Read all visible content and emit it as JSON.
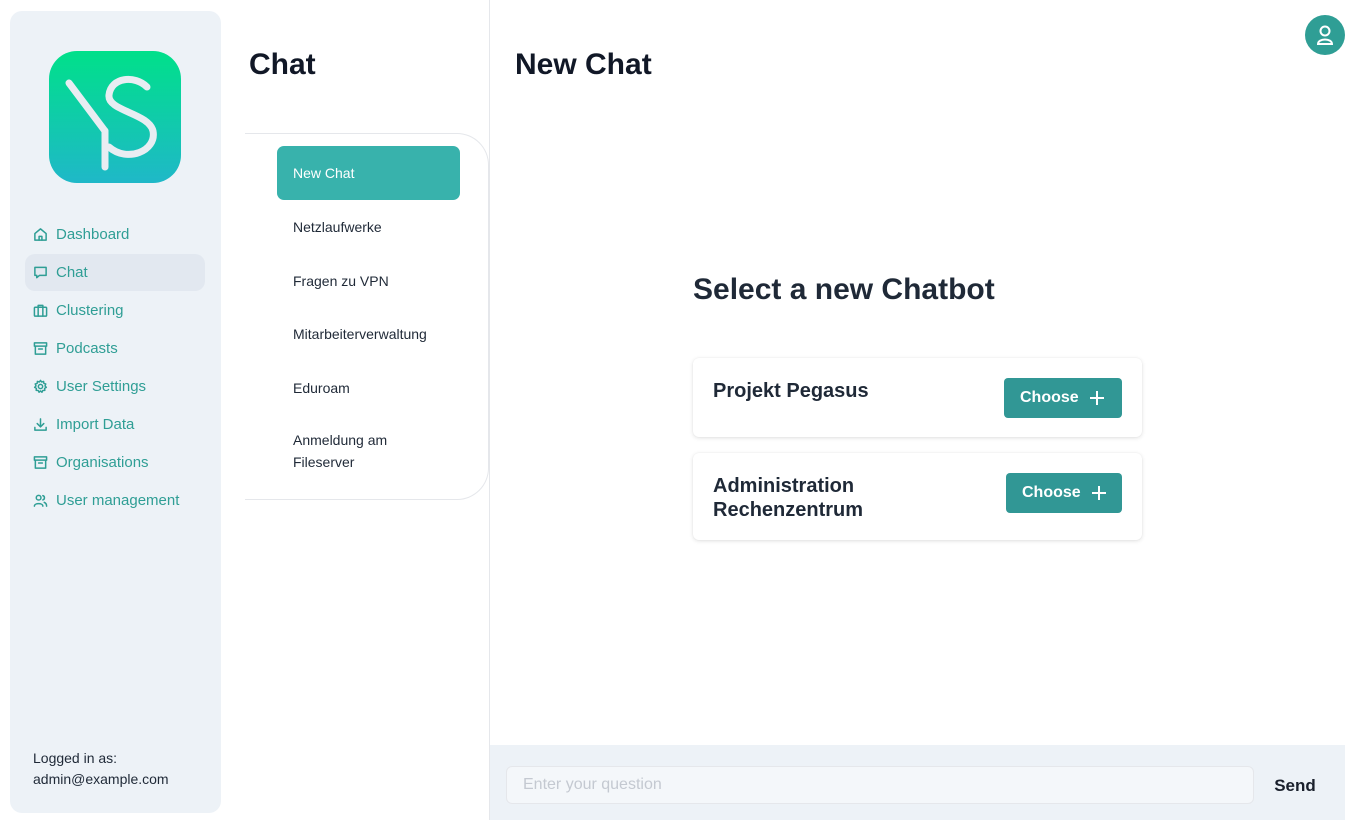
{
  "app": {
    "logo_text": "YS"
  },
  "sidebar": {
    "items": [
      {
        "label": "Dashboard",
        "icon": "home-icon",
        "active": false
      },
      {
        "label": "Chat",
        "icon": "chat-bubble-icon",
        "active": true
      },
      {
        "label": "Clustering",
        "icon": "briefcase-icon",
        "active": false
      },
      {
        "label": "Podcasts",
        "icon": "archive-icon",
        "active": false
      },
      {
        "label": "User Settings",
        "icon": "gear-icon",
        "active": false
      },
      {
        "label": "Import Data",
        "icon": "download-icon",
        "active": false
      },
      {
        "label": "Organisations",
        "icon": "archive-icon",
        "active": false
      },
      {
        "label": "User management",
        "icon": "users-icon",
        "active": false
      }
    ],
    "logged_in_label": "Logged in as:",
    "logged_in_user": "admin@example.com"
  },
  "chat_panel": {
    "title": "Chat",
    "chats": [
      {
        "label": "New Chat",
        "active": true
      },
      {
        "label": "Netzlaufwerke",
        "active": false
      },
      {
        "label": "Fragen zu VPN",
        "active": false
      },
      {
        "label": "Mitarbeiterverwaltung",
        "active": false
      },
      {
        "label": "Eduroam",
        "active": false
      },
      {
        "label": "Anmeldung am Fileserver",
        "active": false
      }
    ]
  },
  "main": {
    "title": "New Chat",
    "select_title": "Select a new Chatbot",
    "chatbots": [
      {
        "name": "Projekt Pegasus",
        "button_label": "Choose"
      },
      {
        "name": "Administration Rechenzentrum",
        "button_label": "Choose"
      }
    ]
  },
  "composer": {
    "placeholder": "Enter your question",
    "value": "",
    "send_label": "Send"
  },
  "colors": {
    "accent": "#319795",
    "nav_text": "#2f9e95",
    "active_chat": "#38b2ac",
    "sidebar_bg": "#edf2f7"
  }
}
